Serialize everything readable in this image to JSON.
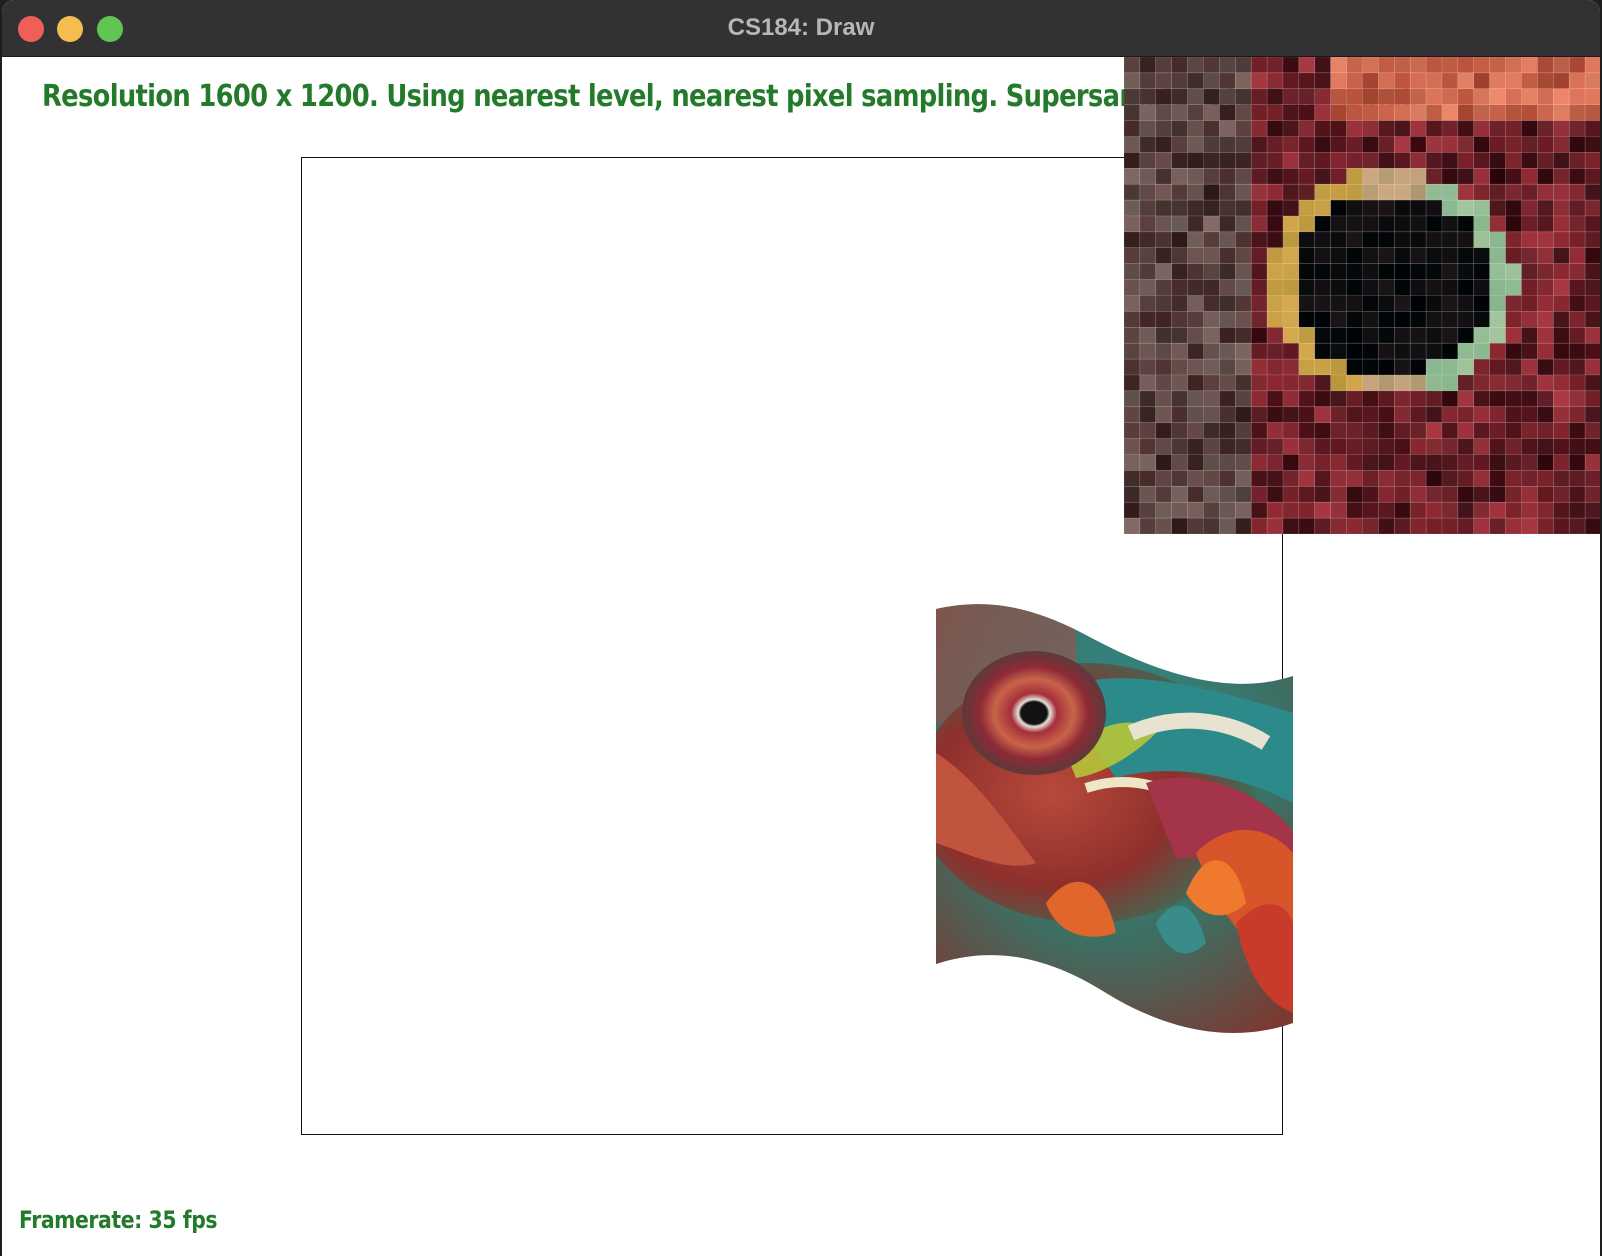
{
  "window": {
    "title": "CS184: Draw"
  },
  "status": {
    "text": "Resolution 1600 x 1200. Using nearest level, nearest pixel sampling. Supersample rate 1 per pixel.",
    "framerate": "Framerate: 35 fps"
  },
  "colors": {
    "status_text": "#237a2a",
    "titlebar": "#323234",
    "close": "#ee5f57",
    "minimize": "#f5bd4f",
    "zoom": "#61c554"
  },
  "icons": [
    "close-icon",
    "minimize-icon",
    "zoom-icon"
  ]
}
